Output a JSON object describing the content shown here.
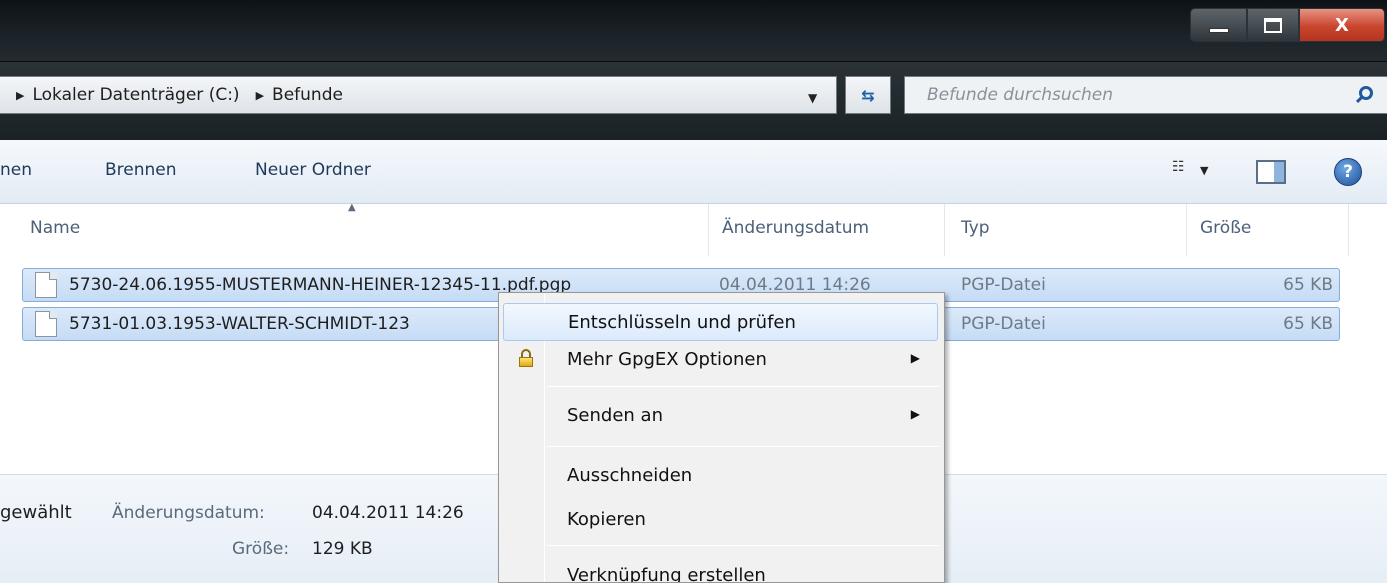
{
  "window": {
    "minimize_icon": "minimize-icon",
    "maximize_icon": "maximize-icon",
    "close_label": "X"
  },
  "address": {
    "crumbs": [
      "Lokaler Datenträger (C:)",
      "Befunde"
    ],
    "search_placeholder": "Befunde durchsuchen"
  },
  "toolbar": {
    "partial_item": "nen",
    "burn": "Brennen",
    "new_folder": "Neuer Ordner",
    "help_label": "?"
  },
  "columns": {
    "name": "Name",
    "modified": "Änderungsdatum",
    "type": "Typ",
    "size": "Größe"
  },
  "files": [
    {
      "name": "5730-24.06.1955-MUSTERMANN-HEINER-12345-11.pdf.pgp",
      "modified": "04.04.2011 14:26",
      "type": "PGP-Datei",
      "size": "65 KB"
    },
    {
      "name": "5731-01.03.1953-WALTER-SCHMIDT-123",
      "modified": "",
      "type": "PGP-Datei",
      "size": "65 KB"
    }
  ],
  "context_menu": {
    "items": [
      {
        "label": "Entschlüsseln und prüfen",
        "highlighted": true
      },
      {
        "label": "Mehr GpgEX Optionen",
        "icon": "lock-icon",
        "submenu": true
      },
      {
        "label": "Senden an",
        "submenu": true
      },
      {
        "label": "Ausschneiden"
      },
      {
        "label": "Kopieren"
      },
      {
        "label": "Verknüpfung erstellen"
      }
    ]
  },
  "details": {
    "selection_text": "gewählt",
    "modified_label": "Änderungsdatum:",
    "modified_value": "04.04.2011 14:26",
    "size_label": "Größe:",
    "size_value": "129 KB"
  }
}
